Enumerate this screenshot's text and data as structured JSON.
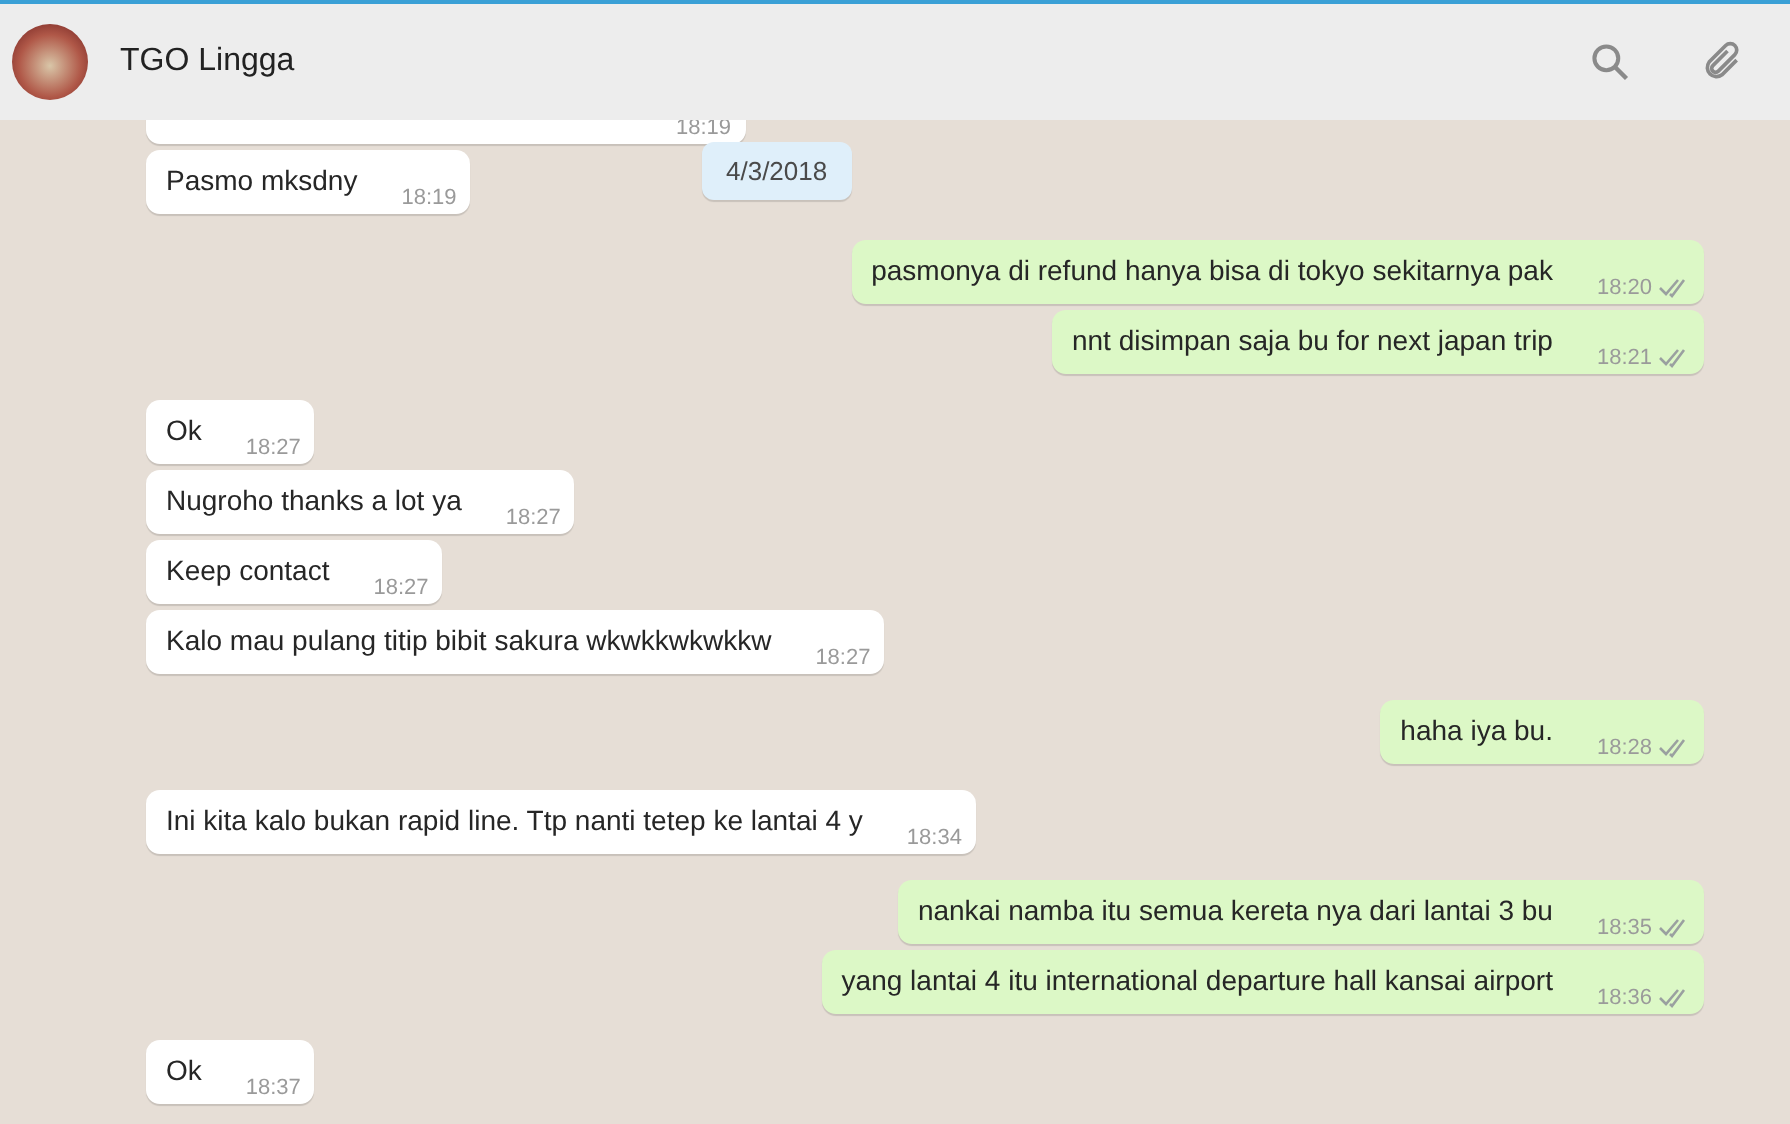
{
  "header": {
    "title": "TGO Lingga"
  },
  "date": "4/3/2018",
  "groups": [
    {
      "outgoing": false,
      "messages": [
        {
          "time": "18:19"
        },
        {
          "text": "Pasmo mksdny",
          "time": "18:19"
        }
      ]
    },
    {
      "outgoing": true,
      "messages": [
        {
          "text": "pasmonya di refund hanya bisa di tokyo sekitarnya pak",
          "time": "18:20",
          "read": false
        },
        {
          "text": "nnt disimpan saja bu for next japan trip",
          "time": "18:21",
          "read": false
        }
      ]
    },
    {
      "outgoing": false,
      "messages": [
        {
          "text": "Ok",
          "time": "18:27"
        },
        {
          "text": "Nugroho thanks a lot ya",
          "time": "18:27"
        },
        {
          "text": "Keep contact",
          "time": "18:27"
        },
        {
          "text": "Kalo mau pulang titip bibit sakura wkwkkwkwkkw",
          "time": "18:27"
        }
      ]
    },
    {
      "outgoing": true,
      "messages": [
        {
          "text": "haha iya bu.",
          "time": "18:28",
          "read": false
        }
      ]
    },
    {
      "outgoing": false,
      "messages": [
        {
          "text": "Ini kita kalo bukan rapid line. Ttp nanti tetep ke lantai 4 y",
          "time": "18:34"
        }
      ]
    },
    {
      "outgoing": true,
      "messages": [
        {
          "text": "nankai namba itu semua kereta nya dari lantai 3 bu",
          "time": "18:35",
          "read": false
        },
        {
          "text": "yang lantai 4 itu international departure hall kansai airport",
          "time": "18:36",
          "read": false
        }
      ]
    },
    {
      "outgoing": false,
      "messages": [
        {
          "text": "Ok",
          "time": "18:37"
        }
      ]
    }
  ]
}
